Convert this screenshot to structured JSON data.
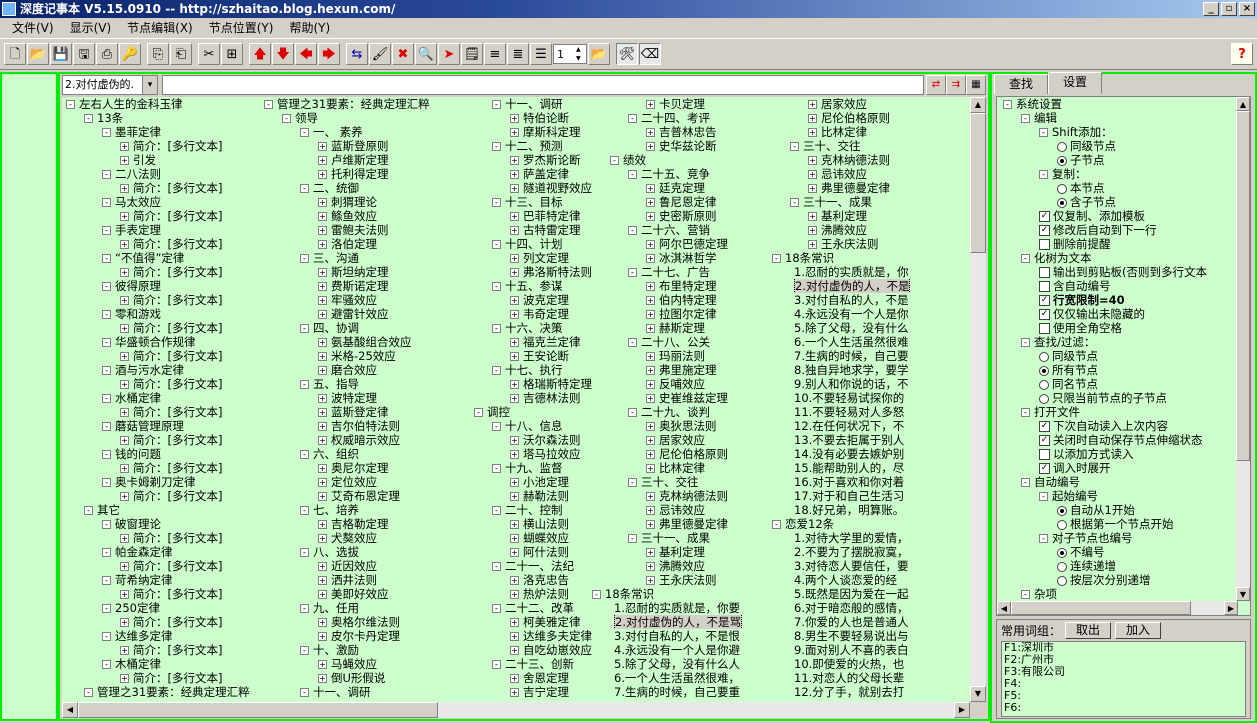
{
  "window": {
    "title": "深度记事本 V5.15.0910 -- http://szhaitao.blog.hexun.com/"
  },
  "menu": [
    "文件(V)",
    "显示(V)",
    "节点编辑(X)",
    "节点位置(Y)",
    "帮助(Y)"
  ],
  "toolbar": {
    "spin_value": "1"
  },
  "address": {
    "label": "2.对付虚伪的.",
    "dropdown": "▾",
    "value": ""
  },
  "tree_columns": [
    [
      {
        "l": 0,
        "t": "左右人生的金科玉律",
        "b": "-"
      },
      {
        "l": 1,
        "t": "13条",
        "b": "-"
      },
      {
        "l": 2,
        "t": "墨菲定律",
        "b": "-"
      },
      {
        "l": 3,
        "t": "简介：[多行文本]",
        "b": "+"
      },
      {
        "l": 3,
        "t": "引发",
        "b": "+"
      },
      {
        "l": 2,
        "t": "二八法则",
        "b": "-"
      },
      {
        "l": 3,
        "t": "简介：[多行文本]",
        "b": "+"
      },
      {
        "l": 2,
        "t": "马太效应",
        "b": "-"
      },
      {
        "l": 3,
        "t": "简介：[多行文本]",
        "b": "+"
      },
      {
        "l": 2,
        "t": "手表定理",
        "b": "-"
      },
      {
        "l": 3,
        "t": "简介：[多行文本]",
        "b": "+"
      },
      {
        "l": 2,
        "t": "“不值得”定律",
        "b": "-"
      },
      {
        "l": 3,
        "t": "简介：[多行文本]",
        "b": "+"
      },
      {
        "l": 2,
        "t": "彼得原理",
        "b": "-"
      },
      {
        "l": 3,
        "t": "简介：[多行文本]",
        "b": "+"
      },
      {
        "l": 2,
        "t": "零和游戏",
        "b": "-"
      },
      {
        "l": 3,
        "t": "简介：[多行文本]",
        "b": "+"
      },
      {
        "l": 2,
        "t": "华盛顿合作规律",
        "b": "-"
      },
      {
        "l": 3,
        "t": "简介：[多行文本]",
        "b": "+"
      },
      {
        "l": 2,
        "t": "酒与污水定律",
        "b": "-"
      },
      {
        "l": 3,
        "t": "简介：[多行文本]",
        "b": "+"
      },
      {
        "l": 2,
        "t": "水桶定律",
        "b": "-"
      },
      {
        "l": 3,
        "t": "简介：[多行文本]",
        "b": "+"
      },
      {
        "l": 2,
        "t": "蘑菇管理原理",
        "b": "-"
      },
      {
        "l": 3,
        "t": "简介：[多行文本]",
        "b": "+"
      },
      {
        "l": 2,
        "t": "钱的问题",
        "b": "-"
      },
      {
        "l": 3,
        "t": "简介：[多行文本]",
        "b": "+"
      },
      {
        "l": 2,
        "t": "奥卡姆剃刀定律",
        "b": "-"
      },
      {
        "l": 3,
        "t": "简介：[多行文本]",
        "b": "+"
      },
      {
        "l": 1,
        "t": "其它",
        "b": "-"
      },
      {
        "l": 2,
        "t": "破窗理论",
        "b": "-"
      },
      {
        "l": 3,
        "t": "简介：[多行文本]",
        "b": "+"
      },
      {
        "l": 2,
        "t": "帕金森定律",
        "b": "-"
      },
      {
        "l": 3,
        "t": "简介：[多行文本]",
        "b": "+"
      },
      {
        "l": 2,
        "t": "苛希纳定律",
        "b": "-"
      },
      {
        "l": 3,
        "t": "简介：[多行文本]",
        "b": "+"
      },
      {
        "l": 2,
        "t": "250定律",
        "b": "-"
      },
      {
        "l": 3,
        "t": "简介：[多行文本]",
        "b": "+"
      },
      {
        "l": 2,
        "t": "达维多定律",
        "b": "-"
      },
      {
        "l": 3,
        "t": "简介：[多行文本]",
        "b": "+"
      },
      {
        "l": 2,
        "t": "木桶定律",
        "b": "-"
      },
      {
        "l": 3,
        "t": "简介：[多行文本]",
        "b": "+"
      },
      {
        "l": 1,
        "t": "管理之31要素：经典定理汇粹",
        "b": "-"
      }
    ],
    [
      {
        "l": 0,
        "t": "管理之31要素：经典定理汇粹",
        "b": "-"
      },
      {
        "l": 1,
        "t": "领导",
        "b": "-"
      },
      {
        "l": 2,
        "t": "一、 素养",
        "b": "-"
      },
      {
        "l": 3,
        "t": "蓝斯登原则",
        "b": "+"
      },
      {
        "l": 3,
        "t": "卢维斯定理",
        "b": "+"
      },
      {
        "l": 3,
        "t": "托利得定理",
        "b": "+"
      },
      {
        "l": 2,
        "t": "二、统御",
        "b": "-"
      },
      {
        "l": 3,
        "t": "刺猬理论",
        "b": "+"
      },
      {
        "l": 3,
        "t": "鲦鱼效应",
        "b": "+"
      },
      {
        "l": 3,
        "t": "雷鲍夫法则",
        "b": "+"
      },
      {
        "l": 3,
        "t": "洛伯定理",
        "b": "+"
      },
      {
        "l": 2,
        "t": "三、沟通",
        "b": "-"
      },
      {
        "l": 3,
        "t": "斯坦纳定理",
        "b": "+"
      },
      {
        "l": 3,
        "t": "费斯诺定理",
        "b": "+"
      },
      {
        "l": 3,
        "t": "牢骚效应",
        "b": "+"
      },
      {
        "l": 3,
        "t": "避雷针效应",
        "b": "+"
      },
      {
        "l": 2,
        "t": "四、协调",
        "b": "-"
      },
      {
        "l": 3,
        "t": "氨基酸组合效应",
        "b": "+"
      },
      {
        "l": 3,
        "t": "米格-25效应",
        "b": "+"
      },
      {
        "l": 3,
        "t": "磨合效应",
        "b": "+"
      },
      {
        "l": 2,
        "t": "五、指导",
        "b": "-"
      },
      {
        "l": 3,
        "t": "波特定理",
        "b": "+"
      },
      {
        "l": 3,
        "t": "蓝斯登定律",
        "b": "+"
      },
      {
        "l": 3,
        "t": "吉尔伯特法则",
        "b": "+"
      },
      {
        "l": 3,
        "t": "权威暗示效应",
        "b": "+"
      },
      {
        "l": 2,
        "t": "六、组织",
        "b": "-"
      },
      {
        "l": 3,
        "t": "奥尼尔定理",
        "b": "+"
      },
      {
        "l": 3,
        "t": "定位效应",
        "b": "+"
      },
      {
        "l": 3,
        "t": "艾奇布恩定理",
        "b": "+"
      },
      {
        "l": 2,
        "t": "七、培养",
        "b": "-"
      },
      {
        "l": 3,
        "t": "吉格勒定理",
        "b": "+"
      },
      {
        "l": 3,
        "t": "犬獒效应",
        "b": "+"
      },
      {
        "l": 2,
        "t": "八、选拔",
        "b": "-"
      },
      {
        "l": 3,
        "t": "近因效应",
        "b": "+"
      },
      {
        "l": 3,
        "t": "洒井法则",
        "b": "+"
      },
      {
        "l": 3,
        "t": "美即好效应",
        "b": "+"
      },
      {
        "l": 2,
        "t": "九、任用",
        "b": "-"
      },
      {
        "l": 3,
        "t": "奥格尔维法则",
        "b": "+"
      },
      {
        "l": 3,
        "t": "皮尔卡丹定理",
        "b": "+"
      },
      {
        "l": 2,
        "t": "十、激励",
        "b": "-"
      },
      {
        "l": 3,
        "t": "马蝇效应",
        "b": "+"
      },
      {
        "l": 3,
        "t": "倒U形假说",
        "b": "+"
      },
      {
        "l": 2,
        "t": "十一、调研",
        "b": "-"
      }
    ],
    [
      {
        "l": 1,
        "t": "十一、调研",
        "b": "-"
      },
      {
        "l": 2,
        "t": "特伯论断",
        "b": "+"
      },
      {
        "l": 2,
        "t": "摩斯科定理",
        "b": "+"
      },
      {
        "l": 1,
        "t": "十二、预测",
        "b": "-"
      },
      {
        "l": 2,
        "t": "罗杰斯论断",
        "b": "+"
      },
      {
        "l": 2,
        "t": "萨盖定律",
        "b": "+"
      },
      {
        "l": 2,
        "t": "隧道视野效应",
        "b": "+"
      },
      {
        "l": 1,
        "t": "十三、目标",
        "b": "-"
      },
      {
        "l": 2,
        "t": "巴菲特定律",
        "b": "+"
      },
      {
        "l": 2,
        "t": "古特雷定理",
        "b": "+"
      },
      {
        "l": 1,
        "t": "十四、计划",
        "b": "-"
      },
      {
        "l": 2,
        "t": "列文定理",
        "b": "+"
      },
      {
        "l": 2,
        "t": "弗洛斯特法则",
        "b": "+"
      },
      {
        "l": 1,
        "t": "十五、参谋",
        "b": "-"
      },
      {
        "l": 2,
        "t": "波克定理",
        "b": "+"
      },
      {
        "l": 2,
        "t": "韦奇定理",
        "b": "+"
      },
      {
        "l": 1,
        "t": "十六、决策",
        "b": "-"
      },
      {
        "l": 2,
        "t": "福克兰定律",
        "b": "+"
      },
      {
        "l": 2,
        "t": "王安论断",
        "b": "+"
      },
      {
        "l": 1,
        "t": "十七、执行",
        "b": "-"
      },
      {
        "l": 2,
        "t": "格瑞斯特定理",
        "b": "+"
      },
      {
        "l": 2,
        "t": "吉德林法则",
        "b": "+"
      },
      {
        "l": 0,
        "t": "调控",
        "b": "-"
      },
      {
        "l": 1,
        "t": "十八、信息",
        "b": "-"
      },
      {
        "l": 2,
        "t": "沃尔森法则",
        "b": "+"
      },
      {
        "l": 2,
        "t": "塔马拉效应",
        "b": "+"
      },
      {
        "l": 1,
        "t": "十九、监督",
        "b": "-"
      },
      {
        "l": 2,
        "t": "小池定理",
        "b": "+"
      },
      {
        "l": 2,
        "t": "赫勒法则",
        "b": "+"
      },
      {
        "l": 1,
        "t": "二十、控制",
        "b": "-"
      },
      {
        "l": 2,
        "t": "横山法则",
        "b": "+"
      },
      {
        "l": 2,
        "t": "蝴蝶效应",
        "b": "+"
      },
      {
        "l": 2,
        "t": "阿什法则",
        "b": "+"
      },
      {
        "l": 1,
        "t": "二十一、法纪",
        "b": "-"
      },
      {
        "l": 2,
        "t": "洛克忠告",
        "b": "+"
      },
      {
        "l": 2,
        "t": "热炉法则",
        "b": "+"
      },
      {
        "l": 1,
        "t": "二十二、改革",
        "b": "-"
      },
      {
        "l": 2,
        "t": "柯美雅定律",
        "b": "+"
      },
      {
        "l": 2,
        "t": "达维多夫定律",
        "b": "+"
      },
      {
        "l": 2,
        "t": "自吃幼崽效应",
        "b": "+"
      },
      {
        "l": 1,
        "t": "二十三、创新",
        "b": "-"
      },
      {
        "l": 2,
        "t": "舍恩定理",
        "b": "+"
      },
      {
        "l": 2,
        "t": "吉宁定理",
        "b": "+"
      }
    ],
    [
      {
        "l": 3,
        "t": "卡贝定理",
        "b": "+"
      },
      {
        "l": 2,
        "t": "二十四、考评",
        "b": "-"
      },
      {
        "l": 3,
        "t": "吉普林忠告",
        "b": "+"
      },
      {
        "l": 3,
        "t": "史华兹论断",
        "b": "+"
      },
      {
        "l": 1,
        "t": "绩效",
        "b": "-"
      },
      {
        "l": 2,
        "t": "二十五、竞争",
        "b": "-"
      },
      {
        "l": 3,
        "t": "廷克定理",
        "b": "+"
      },
      {
        "l": 3,
        "t": "鲁尼恩定律",
        "b": "+"
      },
      {
        "l": 3,
        "t": "史密斯原则",
        "b": "+"
      },
      {
        "l": 2,
        "t": "二十六、营销",
        "b": "-"
      },
      {
        "l": 3,
        "t": "阿尔巴德定理",
        "b": "+"
      },
      {
        "l": 3,
        "t": "冰淇淋哲学",
        "b": "+"
      },
      {
        "l": 2,
        "t": "二十七、广告",
        "b": "-"
      },
      {
        "l": 3,
        "t": "布里特定理",
        "b": "+"
      },
      {
        "l": 3,
        "t": "伯内特定理",
        "b": "+"
      },
      {
        "l": 3,
        "t": "拉图尔定律",
        "b": "+"
      },
      {
        "l": 3,
        "t": "赫斯定理",
        "b": "+"
      },
      {
        "l": 2,
        "t": "二十八、公关",
        "b": "-"
      },
      {
        "l": 3,
        "t": "玛丽法则",
        "b": "+"
      },
      {
        "l": 3,
        "t": "弗里施定理",
        "b": "+"
      },
      {
        "l": 3,
        "t": "反哺效应",
        "b": "+"
      },
      {
        "l": 3,
        "t": "史崔维兹定理",
        "b": "+"
      },
      {
        "l": 2,
        "t": "二十九、谈判",
        "b": "-"
      },
      {
        "l": 3,
        "t": "奥狄思法则",
        "b": "+"
      },
      {
        "l": 3,
        "t": "居家效应",
        "b": "+"
      },
      {
        "l": 3,
        "t": "尼伦伯格原则",
        "b": "+"
      },
      {
        "l": 3,
        "t": "比林定律",
        "b": "+"
      },
      {
        "l": 2,
        "t": "三十、交往",
        "b": "-"
      },
      {
        "l": 3,
        "t": "克林纳德法则",
        "b": "+"
      },
      {
        "l": 3,
        "t": "忌讳效应",
        "b": "+"
      },
      {
        "l": 3,
        "t": "弗里德曼定律",
        "b": "+"
      },
      {
        "l": 2,
        "t": "三十一、成果",
        "b": "-"
      },
      {
        "l": 3,
        "t": "基利定理",
        "b": "+"
      },
      {
        "l": 3,
        "t": "沸腾效应",
        "b": "+"
      },
      {
        "l": 3,
        "t": "王永庆法则",
        "b": "+"
      },
      {
        "l": 0,
        "t": "18条常识",
        "b": "-"
      },
      {
        "l": 1,
        "t": "1.忍耐的实质就是，你要",
        "b": ""
      },
      {
        "l": 1,
        "t": "2.对付虚伪的人，不是骂",
        "b": "",
        "sel": true
      },
      {
        "l": 1,
        "t": "3.对付自私的人，不是恨",
        "b": ""
      },
      {
        "l": 1,
        "t": "4.永远没有一个人是你避",
        "b": ""
      },
      {
        "l": 1,
        "t": "5.除了父母，没有什么人",
        "b": ""
      },
      {
        "l": 1,
        "t": "6.一个人生活虽然很难，",
        "b": ""
      },
      {
        "l": 1,
        "t": "7.生病的时候，自己要重",
        "b": ""
      }
    ],
    [
      {
        "l": 2,
        "t": "居家效应",
        "b": "+"
      },
      {
        "l": 2,
        "t": "尼伦伯格原则",
        "b": "+"
      },
      {
        "l": 2,
        "t": "比林定律",
        "b": "+"
      },
      {
        "l": 1,
        "t": "三十、交往",
        "b": "-"
      },
      {
        "l": 2,
        "t": "克林纳德法则",
        "b": "+"
      },
      {
        "l": 2,
        "t": "忌讳效应",
        "b": "+"
      },
      {
        "l": 2,
        "t": "弗里德曼定律",
        "b": "+"
      },
      {
        "l": 1,
        "t": "三十一、成果",
        "b": "-"
      },
      {
        "l": 2,
        "t": "基利定理",
        "b": "+"
      },
      {
        "l": 2,
        "t": "沸腾效应",
        "b": "+"
      },
      {
        "l": 2,
        "t": "王永庆法则",
        "b": "+"
      },
      {
        "l": 0,
        "t": "18条常识",
        "b": "-"
      },
      {
        "l": 1,
        "t": "1.忍耐的实质就是，你",
        "b": ""
      },
      {
        "l": 1,
        "t": "2.对付虚伪的人，不是",
        "b": "",
        "sel": true
      },
      {
        "l": 1,
        "t": "3.对付自私的人，不是",
        "b": ""
      },
      {
        "l": 1,
        "t": "4.永远没有一个人是你",
        "b": ""
      },
      {
        "l": 1,
        "t": "5.除了父母，没有什么",
        "b": ""
      },
      {
        "l": 1,
        "t": "6.一个人生活虽然很难",
        "b": ""
      },
      {
        "l": 1,
        "t": "7.生病的时候，自己要",
        "b": ""
      },
      {
        "l": 1,
        "t": "8.独自异地求学，要学",
        "b": ""
      },
      {
        "l": 1,
        "t": "9.别人和你说的话，不",
        "b": ""
      },
      {
        "l": 1,
        "t": "10.不要轻易试探你的",
        "b": ""
      },
      {
        "l": 1,
        "t": "11.不要轻易对人多怒",
        "b": ""
      },
      {
        "l": 1,
        "t": "12.在任何状况下，不",
        "b": ""
      },
      {
        "l": 1,
        "t": "13.不要去拒属于别人",
        "b": ""
      },
      {
        "l": 1,
        "t": "14.没有必要去嫉妒别",
        "b": ""
      },
      {
        "l": 1,
        "t": "15.能帮助别人的，尽",
        "b": ""
      },
      {
        "l": 1,
        "t": "16.对于喜欢和你对着",
        "b": ""
      },
      {
        "l": 1,
        "t": "17.对于和自己生活习",
        "b": ""
      },
      {
        "l": 1,
        "t": "18.好兄弟，明算账。",
        "b": ""
      },
      {
        "l": 0,
        "t": "恋爱12条",
        "b": "-"
      },
      {
        "l": 1,
        "t": "1.对待大学里的爱情，",
        "b": ""
      },
      {
        "l": 1,
        "t": "2.不要为了摆脱寂寞，",
        "b": ""
      },
      {
        "l": 1,
        "t": "3.对待恋人要信任，要",
        "b": ""
      },
      {
        "l": 1,
        "t": "4.两个人谈恋爱的经",
        "b": ""
      },
      {
        "l": 1,
        "t": "5.既然是因为爱在一起",
        "b": ""
      },
      {
        "l": 1,
        "t": "6.对于暗恋般的感情，",
        "b": ""
      },
      {
        "l": 1,
        "t": "7.你爱的人也是普通人",
        "b": ""
      },
      {
        "l": 1,
        "t": "8.男生不要轻易说出与",
        "b": ""
      },
      {
        "l": 1,
        "t": "9.面对别人不喜的表白",
        "b": ""
      },
      {
        "l": 1,
        "t": "10.即使爱的火热，也",
        "b": ""
      },
      {
        "l": 1,
        "t": "11.对恋人的父母长辈",
        "b": ""
      },
      {
        "l": 1,
        "t": "12.分了手，就别去打",
        "b": ""
      }
    ]
  ],
  "right_panel": {
    "tabs": [
      "查找",
      "设置"
    ],
    "active_tab": "设置",
    "settings": [
      {
        "l": 0,
        "k": "bx",
        "v": "-",
        "t": "系统设置"
      },
      {
        "l": 1,
        "k": "bx",
        "v": "-",
        "t": "编辑"
      },
      {
        "l": 2,
        "k": "bx",
        "v": "-",
        "t": "Shift添加："
      },
      {
        "l": 3,
        "k": "rb",
        "v": false,
        "t": "同级节点"
      },
      {
        "l": 3,
        "k": "rb",
        "v": true,
        "t": "子节点"
      },
      {
        "l": 2,
        "k": "bx",
        "v": "-",
        "t": "复制："
      },
      {
        "l": 3,
        "k": "rb",
        "v": false,
        "t": "本节点"
      },
      {
        "l": 3,
        "k": "rb",
        "v": true,
        "t": "含子节点"
      },
      {
        "l": 2,
        "k": "cb",
        "v": true,
        "t": "仅复制、添加模板"
      },
      {
        "l": 2,
        "k": "cb",
        "v": true,
        "t": "修改后自动到下一行"
      },
      {
        "l": 2,
        "k": "cb",
        "v": false,
        "t": "删除前提醒"
      },
      {
        "l": 1,
        "k": "bx",
        "v": "-",
        "t": "化树为文本"
      },
      {
        "l": 2,
        "k": "cb",
        "v": false,
        "t": "输出到剪贴板(否则到多行文本"
      },
      {
        "l": 2,
        "k": "cb",
        "v": false,
        "t": "含自动编号"
      },
      {
        "l": 2,
        "k": "cb",
        "v": true,
        "t": "行宽限制=40",
        "bold": true
      },
      {
        "l": 2,
        "k": "cb",
        "v": true,
        "t": "仅仅输出未隐藏的"
      },
      {
        "l": 2,
        "k": "cb",
        "v": false,
        "t": "使用全角空格"
      },
      {
        "l": 1,
        "k": "bx",
        "v": "-",
        "t": "查找/过滤："
      },
      {
        "l": 2,
        "k": "rb",
        "v": false,
        "t": "同级节点"
      },
      {
        "l": 2,
        "k": "rb",
        "v": true,
        "t": "所有节点"
      },
      {
        "l": 2,
        "k": "rb",
        "v": false,
        "t": "同名节点"
      },
      {
        "l": 2,
        "k": "rb",
        "v": false,
        "t": "只限当前节点的子节点"
      },
      {
        "l": 1,
        "k": "bx",
        "v": "-",
        "t": "打开文件"
      },
      {
        "l": 2,
        "k": "cb",
        "v": true,
        "t": "下次自动读入上次内容"
      },
      {
        "l": 2,
        "k": "cb",
        "v": true,
        "t": "关闭时自动保存节点伸缩状态"
      },
      {
        "l": 2,
        "k": "cb",
        "v": false,
        "t": "以添加方式读入"
      },
      {
        "l": 2,
        "k": "cb",
        "v": true,
        "t": "调入时展开"
      },
      {
        "l": 1,
        "k": "bx",
        "v": "-",
        "t": "自动编号"
      },
      {
        "l": 2,
        "k": "bx",
        "v": "-",
        "t": "起始编号"
      },
      {
        "l": 3,
        "k": "rb",
        "v": true,
        "t": "自动从1开始"
      },
      {
        "l": 3,
        "k": "rb",
        "v": false,
        "t": "根据第一个节点开始"
      },
      {
        "l": 2,
        "k": "bx",
        "v": "-",
        "t": "对子节点也编号"
      },
      {
        "l": 3,
        "k": "rb",
        "v": true,
        "t": "不编号"
      },
      {
        "l": 3,
        "k": "rb",
        "v": false,
        "t": "连续递增"
      },
      {
        "l": 3,
        "k": "rb",
        "v": false,
        "t": "按层次分别递增"
      },
      {
        "l": 1,
        "k": "bx",
        "v": "-",
        "t": "杂项"
      }
    ],
    "phrases": {
      "label": "常用词组：",
      "take_btn": "取出",
      "add_btn": "加入",
      "items": [
        "F1:深圳市",
        "F2:广州市",
        "F3:有限公司",
        "F4:",
        "F5:",
        "F6:"
      ]
    }
  }
}
